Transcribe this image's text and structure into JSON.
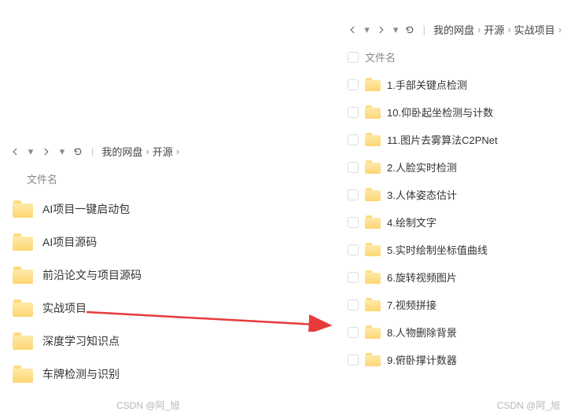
{
  "left": {
    "breadcrumb": [
      "我的网盘",
      "开源"
    ],
    "column_header": "文件名",
    "items": [
      {
        "label": "AI项目一键启动包"
      },
      {
        "label": "AI项目源码"
      },
      {
        "label": "前沿论文与项目源码"
      },
      {
        "label": "实战项目"
      },
      {
        "label": "深度学习知识点"
      },
      {
        "label": "车牌检测与识别"
      }
    ]
  },
  "right": {
    "breadcrumb": [
      "我的网盘",
      "开源",
      "实战项目"
    ],
    "column_header": "文件名",
    "items": [
      {
        "label": "1.手部关键点检测"
      },
      {
        "label": "10.仰卧起坐检测与计数"
      },
      {
        "label": "11.图片去雾算法C2PNet"
      },
      {
        "label": "2.人脸实时检测"
      },
      {
        "label": "3.人体姿态估计"
      },
      {
        "label": "4.绘制文字"
      },
      {
        "label": "5.实时绘制坐标值曲线"
      },
      {
        "label": "6.旋转视频图片"
      },
      {
        "label": "7.视频拼接"
      },
      {
        "label": "8.人物删除背景"
      },
      {
        "label": "9.俯卧撑计数器"
      }
    ]
  },
  "watermark": "CSDN @阿_旭"
}
